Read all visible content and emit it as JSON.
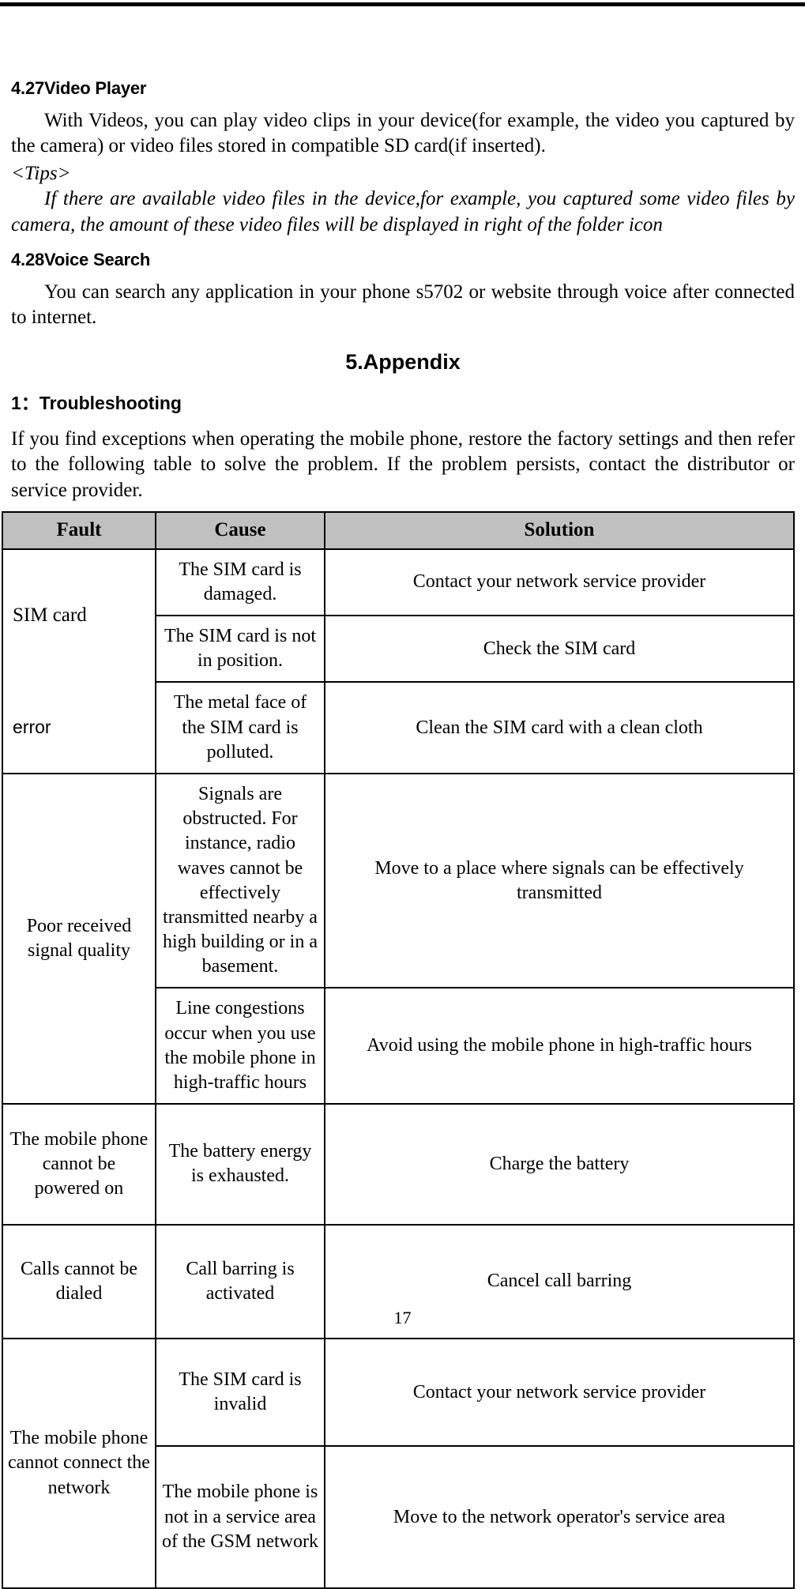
{
  "document": {
    "page_number": "17"
  },
  "sections": {
    "video_player": {
      "heading": "4.27Video Player",
      "paragraph": "With Videos, you can play video clips in your device(for example, the video you captured by the camera) or video files stored in compatible SD card(if inserted).",
      "tips_label": "<Tips>",
      "tips_text": "If there are available video files in the device,for example, you captured some video files by camera, the amount of these video files will be displayed in right of the folder icon"
    },
    "voice_search": {
      "heading": "4.28Voice Search",
      "paragraph": "You can search any application in your phone s5702 or website through voice after connected to internet."
    },
    "appendix": {
      "title": "5.Appendix",
      "troubleshooting_heading": "1：Troubleshooting",
      "intro": "If you find exceptions when operating the mobile phone, restore the factory settings and then refer to the following table to solve the problem. If the problem persists, contact the distributor or service provider."
    }
  },
  "troubleshooting_table": {
    "headers": [
      "Fault",
      "Cause",
      "Solution"
    ],
    "header_background": "#c0c0c0",
    "rows": [
      {
        "fault_top": "SIM card",
        "fault_bottom": "error",
        "entries": [
          {
            "cause": "The SIM card is damaged.",
            "solution": "Contact your network service provider"
          },
          {
            "cause": "The SIM card is not in position.",
            "solution": "Check the SIM card"
          },
          {
            "cause": "The metal face of the SIM card is polluted.",
            "solution": "Clean the SIM card with a clean cloth"
          }
        ]
      },
      {
        "fault": "Poor received signal quality",
        "entries": [
          {
            "cause": "Signals are obstructed. For instance, radio waves cannot be effectively transmitted nearby a high building or in a basement.",
            "solution": "Move to a place where signals can be effectively transmitted"
          },
          {
            "cause": "Line congestions occur when you use the mobile phone in high-traffic hours",
            "solution": "Avoid using the mobile phone in high-traffic hours"
          }
        ]
      },
      {
        "fault": "The mobile phone cannot be powered on",
        "entries": [
          {
            "cause": "The battery energy is exhausted.",
            "solution": "Charge the battery"
          }
        ]
      },
      {
        "fault": "Calls cannot be dialed",
        "entries": [
          {
            "cause": "Call barring is activated",
            "solution": "Cancel call barring"
          }
        ]
      },
      {
        "fault": "The mobile phone cannot connect the network",
        "entries": [
          {
            "cause": "The SIM card is invalid",
            "solution": "Contact your network service provider"
          },
          {
            "cause": "The mobile phone is not in a service area of the GSM network",
            "solution": "Move to the network operator's service area"
          }
        ]
      }
    ]
  }
}
